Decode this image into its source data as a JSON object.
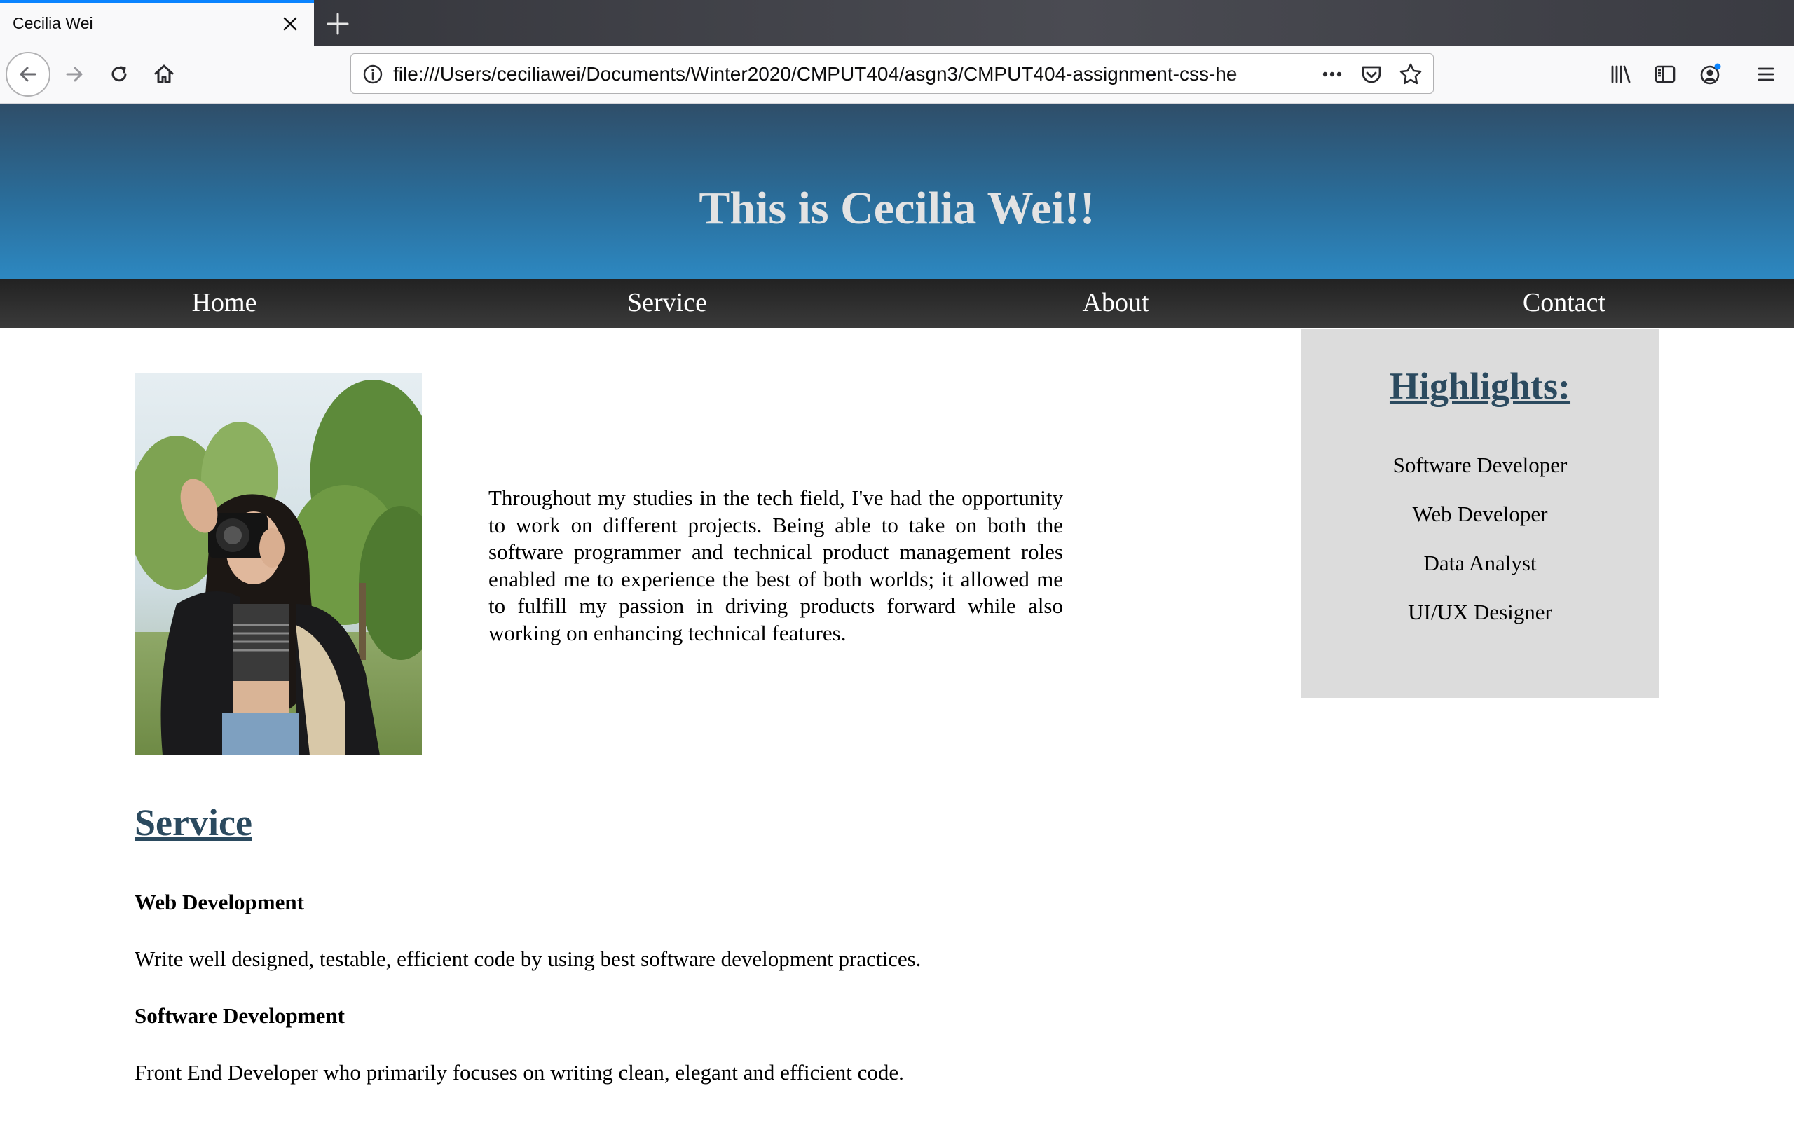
{
  "browser": {
    "tab_title": "Cecilia Wei",
    "url": "file:///Users/ceciliawei/Documents/Winter2020/CMPUT404/asgn3/CMPUT404-assignment-css-he"
  },
  "header": {
    "title": "This is Cecilia Wei!!"
  },
  "nav": {
    "items": [
      "Home",
      "Service",
      "About",
      "Contact"
    ]
  },
  "intro": {
    "text": "Throughout my studies in the tech field, I've had the opportunity to work on different projects. Being able to take on both the software programmer and technical product management roles enabled me to experience the best of both worlds; it allowed me to fulfill my passion in driving products forward while also working on enhancing technical features."
  },
  "highlights": {
    "title": "Highlights:",
    "items": [
      "Software Developer",
      "Web Developer",
      "Data Analyst",
      "UI/UX Designer"
    ]
  },
  "service": {
    "title": "Service",
    "entries": [
      {
        "heading": "Web Development",
        "text": "Write well designed, testable, efficient code by using best software development practices."
      },
      {
        "heading": "Software Development",
        "text": "Front End Developer who primarily focuses on writing clean, elegant and efficient code."
      }
    ]
  },
  "colors": {
    "accent_heading": "#2b4a5f",
    "header_gradient_top": "#2f4e69",
    "header_gradient_bottom": "#2d88c1",
    "nav_bg": "#2b2b2b",
    "sidebar_bg": "#dcdcdc"
  }
}
